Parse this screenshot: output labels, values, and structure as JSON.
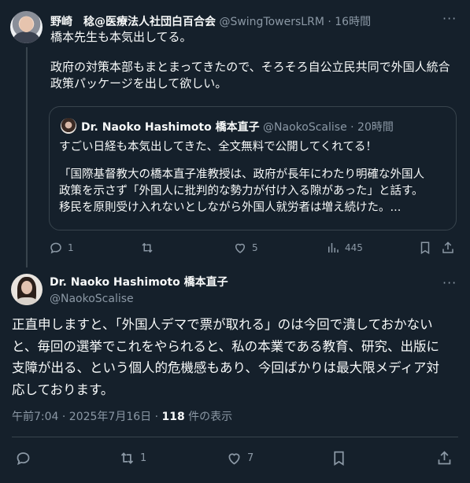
{
  "tweet1": {
    "author_name": "野崎　稔@医療法人社団白百合会",
    "handle": "@SwingTowersLRM",
    "time": "16時間",
    "more_label": "···",
    "body_lines": [
      "橋本先生も本気出してる。",
      "政府の対策本部もまとまってきたので、そろそろ自公立民共同で外国人統合",
      "政策パッケージを出して欲しい。"
    ],
    "quote": {
      "author_name": "Dr. Naoko Hashimoto 橋本直子",
      "handle": "@NaokoScalise",
      "time": "20時間",
      "line1": "すごい日経も本気出してきた、全文無料で公開してくれてる！",
      "lines": [
        "「国際基督教大の橋本直子准教授は、政府が長年にわたり明確な外国人",
        "政策を示さず「外国人に批判的な勢力が付け入る隙があった」と話す。",
        "移民を原則受け入れないとしながら外国人就労者は増え続けた。..."
      ]
    },
    "actions": {
      "replies": "1",
      "reposts": "",
      "likes": "5",
      "views": "445"
    }
  },
  "tweet2": {
    "author_name": "Dr. Naoko Hashimoto 橋本直子",
    "handle": "@NaokoScalise",
    "more_label": "···",
    "body_lines": [
      "正直申しますと、「外国人デマで票が取れる」のは今回で潰しておかない",
      "と、毎回の選挙でこれをやられると、私の本業である教育、研究、出版に",
      "支障が出る、という個人的危機感もあり、今回ばかりは最大限メディア対",
      "応しております。"
    ],
    "timestamp": "午前7:04 · 2025年7月16日 · ",
    "views_count": "118",
    "views_label": " 件の表示",
    "actions": {
      "replies": "",
      "reposts": "1",
      "likes": "7"
    }
  },
  "colors": {
    "background": "#15202b",
    "text": "#f7f9f9",
    "muted": "#8b98a5",
    "border": "#38444d"
  }
}
